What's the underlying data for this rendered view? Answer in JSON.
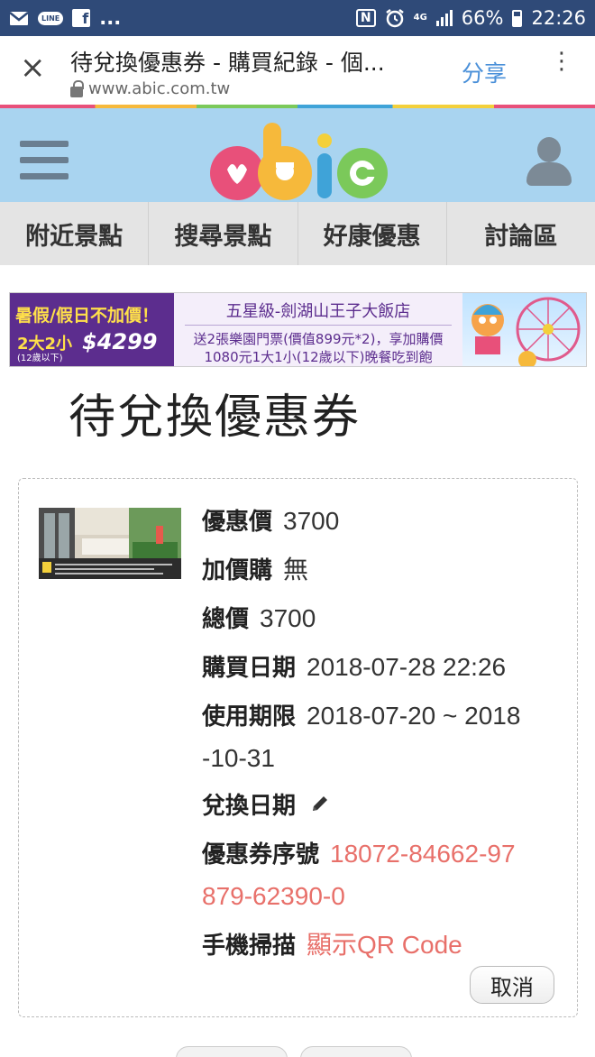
{
  "status_bar": {
    "line_label": "LINE",
    "facebook_label": "f",
    "more": "...",
    "nfc_label": "N",
    "network_type": "4G",
    "battery_percent": "66%",
    "time": "22:26",
    "icons": [
      "gmail-icon",
      "line-icon",
      "facebook-icon",
      "nfc-icon",
      "alarm-icon",
      "signal-icon",
      "battery-icon"
    ]
  },
  "browser": {
    "page_title": "待兌換優惠券 - 購買紀錄 - 個...",
    "url": "www.abic.com.tw",
    "share_label": "分享",
    "close_icon": "×",
    "menu_icon": "⋮"
  },
  "site": {
    "logo_text": "abic",
    "nav_tabs": [
      "附近景點",
      "搜尋景點",
      "好康優惠",
      "討論區"
    ]
  },
  "banner": {
    "promo": "暑假/假日不加價！",
    "qty": "2大2小",
    "age_note": "(12歲以下)",
    "price": "$4299",
    "hotel": "五星級-劍湖山王子大飯店",
    "desc_line1": "送2張樂園門票(價值899元*2)，享加購價",
    "desc_line2": "1080元1大1小(12歲以下)晚餐吃到飽"
  },
  "section_title": "待兌換優惠券",
  "coupon": {
    "price_label": "優惠價",
    "price_value": "3700",
    "addon_label": "加價購",
    "addon_value": "無",
    "total_label": "總價",
    "total_value": "3700",
    "purchase_date_label": "購買日期",
    "purchase_date_value": "2018-07-28 22:26",
    "expiry_label": "使用期限",
    "expiry_value_line1": "2018-07-20 ~ 2018",
    "expiry_value_line2": "-10-31",
    "redeem_date_label": "兌換日期",
    "serial_label": "優惠券序號",
    "serial_line1": "18072-84662-97",
    "serial_line2": "879-62390-0",
    "scan_label": "手機掃描",
    "scan_link": "顯示QR Code",
    "cancel_label": "取消"
  },
  "colors": {
    "status_bar": "#2f4a78",
    "header_bg": "#a9d4f0",
    "link_red": "#e8706a",
    "share_blue": "#4a90d9",
    "banner_purple": "#5c2d8e"
  }
}
